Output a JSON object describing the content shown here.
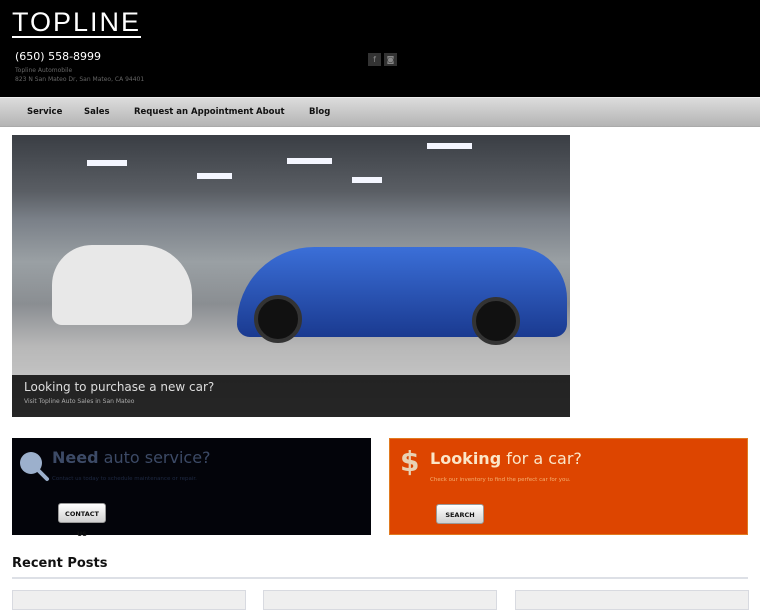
{
  "header": {
    "logo": "TOPLINE",
    "phone": "(650) 558-8999",
    "business_name": "Topline Automobile",
    "address": "823 N San Mateo Dr, San Mateo, CA 94401",
    "social": [
      {
        "icon": "facebook-icon",
        "glyph": "f"
      },
      {
        "icon": "instagram-icon",
        "glyph": "◙"
      }
    ]
  },
  "nav": {
    "items": [
      "Service",
      "Sales",
      "Request an Appointment",
      "About",
      "Blog"
    ]
  },
  "hero": {
    "title": "Looking to purchase a new car?",
    "subtitle": "Visit Topline Auto Sales in San Mateo"
  },
  "service_box": {
    "bold": "Need",
    "rest": " auto service?",
    "text": "Contact us today to schedule maintenance or repair.",
    "button": "CONTACT US",
    "color": "#03040a"
  },
  "sales_box": {
    "bold": "Looking",
    "rest": " for a car?",
    "text": "Check our inventory to find the perfect car for you.",
    "button": "SEARCH",
    "color": "#dd4500"
  },
  "recent_posts": {
    "title": "Recent Posts"
  }
}
